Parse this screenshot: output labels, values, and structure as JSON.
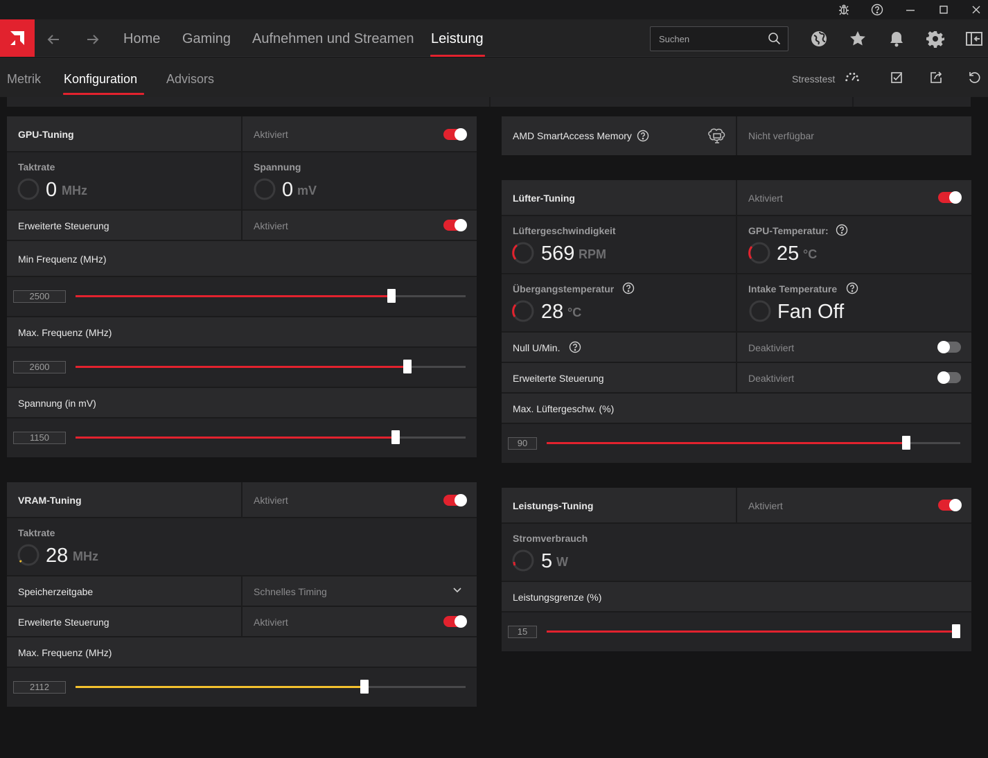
{
  "titlebar": {
    "icons": [
      "bug-icon",
      "help-icon",
      "minimize-icon",
      "maximize-icon",
      "close-icon"
    ]
  },
  "nav": {
    "logo": "amd-logo",
    "items": [
      {
        "label": "Home"
      },
      {
        "label": "Gaming"
      },
      {
        "label": "Aufnehmen und Streamen"
      },
      {
        "label": "Leistung"
      }
    ],
    "active": "Leistung",
    "search": {
      "placeholder": "Suchen",
      "value": ""
    },
    "icons": [
      "globe-icon",
      "star-icon",
      "bell-icon",
      "gear-icon",
      "sidebar-icon"
    ]
  },
  "subnav": {
    "items": [
      {
        "label": "Metrik"
      },
      {
        "label": "Konfiguration"
      },
      {
        "label": "Advisors"
      }
    ],
    "active": "Konfiguration",
    "stresstest_label": "Stresstest"
  },
  "colors": {
    "accent": "#e2222e",
    "vram_accent": "#f4c12e",
    "bg": "#151516",
    "panel": "#242426"
  },
  "gpu": {
    "title": "GPU-Tuning",
    "status": "Aktiviert",
    "enabled": true,
    "clock": {
      "label": "Taktrate",
      "value": "0",
      "unit": "MHz"
    },
    "voltage": {
      "label": "Spannung",
      "value": "0",
      "unit": "mV"
    },
    "advanced": {
      "label": "Erweiterte Steuerung",
      "status": "Aktiviert",
      "enabled": true
    },
    "min_freq": {
      "label": "Min Frequenz (MHz)",
      "value": "2500",
      "fraction": 0.81
    },
    "max_freq": {
      "label": "Max. Frequenz (MHz)",
      "value": "2600",
      "fraction": 0.85
    },
    "volt_slider": {
      "label": "Spannung (in mV)",
      "value": "1150",
      "fraction": 0.82
    }
  },
  "vram": {
    "title": "VRAM-Tuning",
    "status": "Aktiviert",
    "enabled": true,
    "clock": {
      "label": "Taktrate",
      "value": "28",
      "unit": "MHz"
    },
    "timing": {
      "label": "Speicherzeitgabe",
      "value": "Schnelles Timing"
    },
    "advanced": {
      "label": "Erweiterte Steuerung",
      "status": "Aktiviert",
      "enabled": true
    },
    "max_freq": {
      "label": "Max. Frequenz (MHz)",
      "value": "2112",
      "fraction": 0.74
    }
  },
  "sam": {
    "label": "AMD SmartAccess Memory",
    "status": "Nicht verfügbar"
  },
  "fan": {
    "title": "Lüfter-Tuning",
    "status": "Aktiviert",
    "enabled": true,
    "speed": {
      "label": "Lüftergeschwindigkeit",
      "value": "569",
      "unit": "RPM"
    },
    "gpu_temp": {
      "label": "GPU-Temperatur:",
      "value": "25",
      "unit": "°C"
    },
    "junction": {
      "label": "Übergangstemperatur",
      "value": "28",
      "unit": "°C"
    },
    "intake": {
      "label": "Intake Temperature",
      "value": "Fan Off"
    },
    "zero_rpm": {
      "label": "Null U/Min.",
      "status": "Deaktiviert",
      "enabled": false
    },
    "advanced": {
      "label": "Erweiterte Steuerung",
      "status": "Deaktiviert",
      "enabled": false
    },
    "max_speed": {
      "label": "Max. Lüftergeschw. (%)",
      "value": "90",
      "fraction": 0.87
    }
  },
  "power": {
    "title": "Leistungs-Tuning",
    "status": "Aktiviert",
    "enabled": true,
    "consumption": {
      "label": "Stromverbrauch",
      "value": "5",
      "unit": "W"
    },
    "limit": {
      "label": "Leistungsgrenze (%)",
      "value": "15",
      "fraction": 1.0
    }
  }
}
